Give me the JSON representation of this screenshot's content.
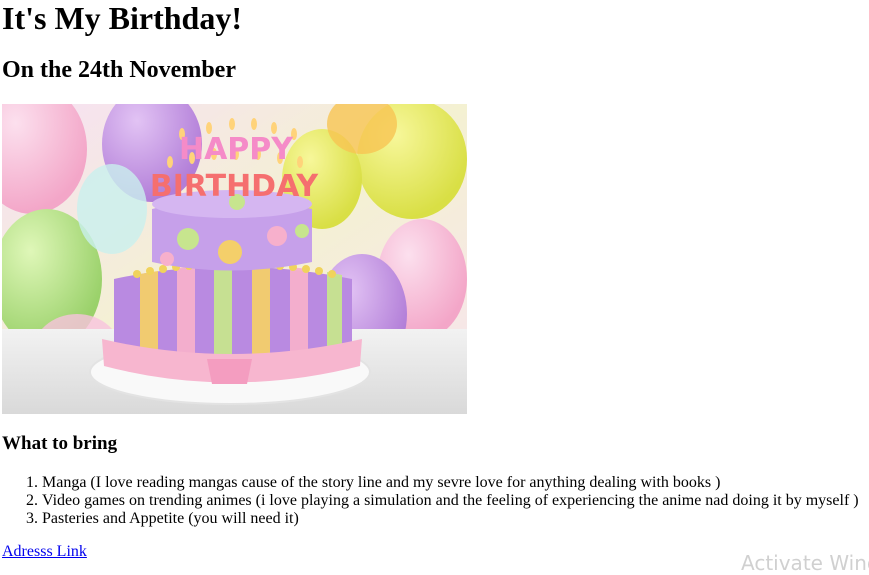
{
  "page": {
    "title": "It's My Birthday!",
    "date": "On the 24th November"
  },
  "image": {
    "cake_text": {
      "line1": "HAPPY",
      "line2": "BIRTHDAY"
    }
  },
  "bring": {
    "heading": "What to bring",
    "items": [
      "Manga (I love reading mangas cause of the story line and my sevre love for anything dealing with books )",
      "Video games on trending animes (i love playing a simulation and the feeling of experiencing the anime nad doing it by myself )",
      "Pasteries and Appetite (you will need it)"
    ]
  },
  "link": {
    "label": "Adresss Link"
  },
  "watermark": {
    "text": "Activate Windows"
  }
}
